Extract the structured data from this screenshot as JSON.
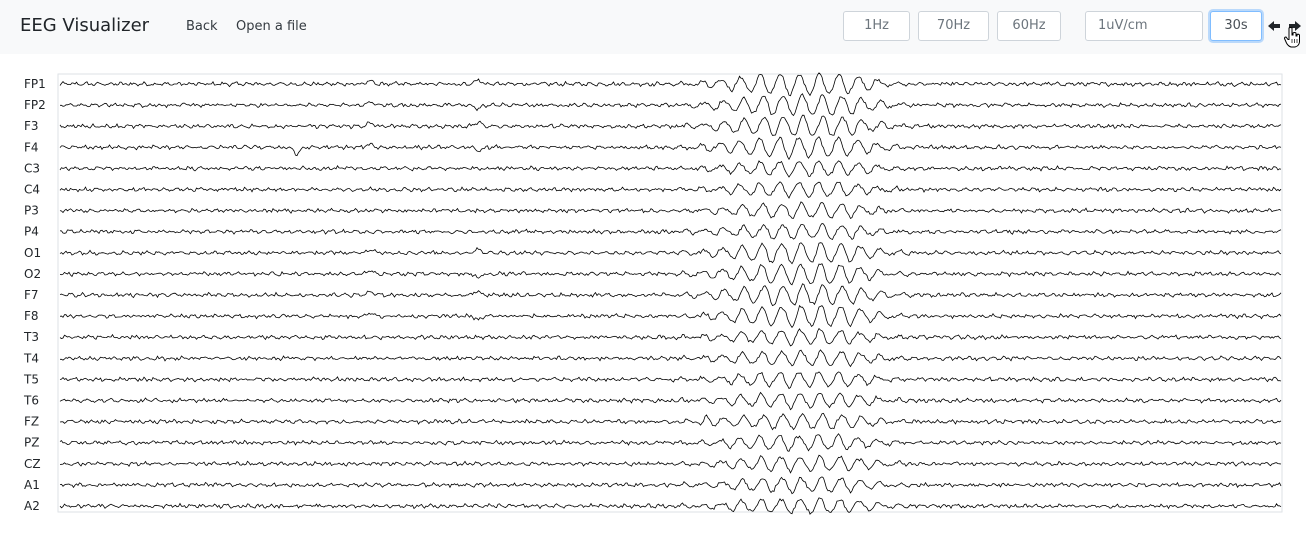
{
  "app": {
    "title": "EEG Visualizer"
  },
  "nav": {
    "back_label": "Back",
    "open_file_label": "Open a file"
  },
  "controls": {
    "high_pass": "1Hz",
    "low_pass": "70Hz",
    "notch": "60Hz",
    "sensitivity": "1uV/cm",
    "timebase": "30s"
  },
  "icons": {
    "prev": "arrow-left-icon",
    "next": "arrow-right-icon",
    "cursor": "hand-pointer-icon"
  },
  "colors": {
    "navbar_bg": "#f8f9fa",
    "trace": "#000000",
    "active_border": "#80bdff"
  },
  "channels": [
    "FP1",
    "FP2",
    "F3",
    "F4",
    "C3",
    "C4",
    "P3",
    "P4",
    "O1",
    "O2",
    "F7",
    "F8",
    "T3",
    "T4",
    "T5",
    "T6",
    "FZ",
    "PZ",
    "CZ",
    "A1",
    "A2"
  ]
}
